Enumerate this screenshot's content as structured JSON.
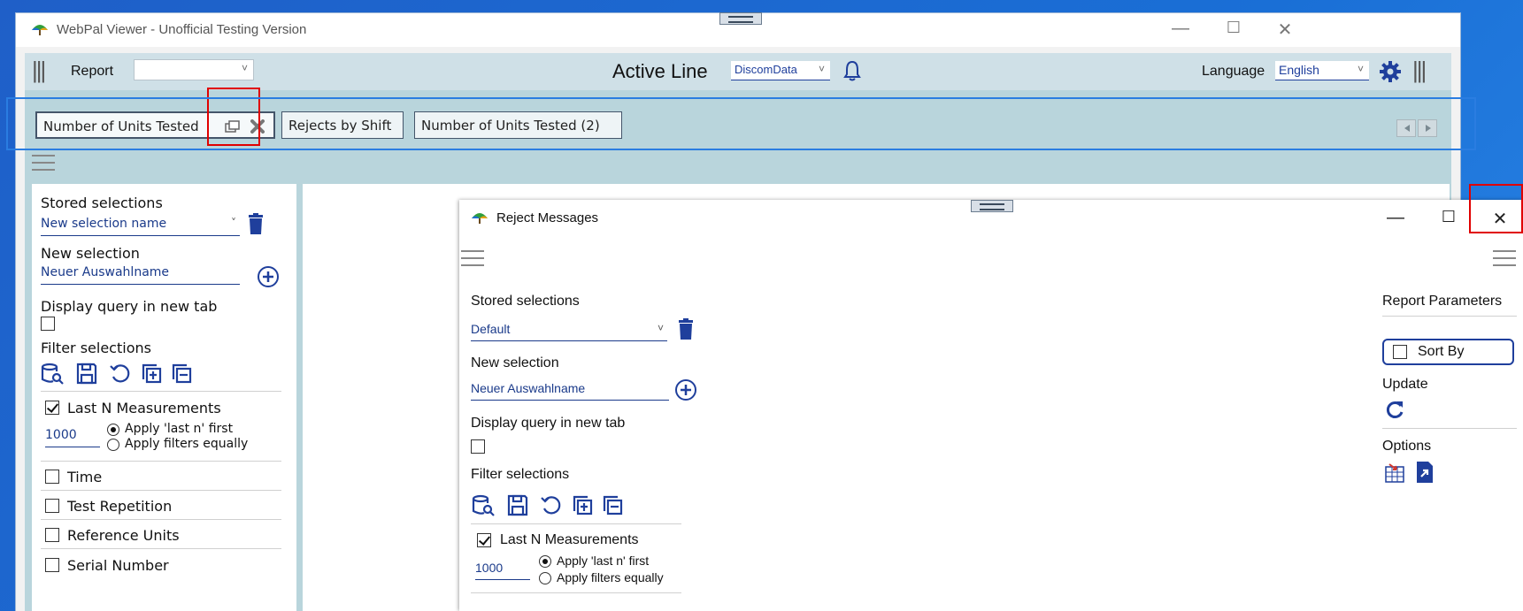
{
  "main_window": {
    "title": "WebPal Viewer - Unofficial Testing Version",
    "controls": {
      "minimize": "—",
      "maximize": "☐",
      "close": "✕"
    }
  },
  "toolbar": {
    "report_label": "Report",
    "report_value": "",
    "active_line_label": "Active Line",
    "active_line_value": "DiscomData",
    "language_label": "Language",
    "language_value": "English"
  },
  "tabs": [
    {
      "label": "Number of Units Tested"
    },
    {
      "label": "Rejects by Shift"
    },
    {
      "label": "Number of Units Tested (2)"
    }
  ],
  "left_panel": {
    "stored_selections_label": "Stored selections",
    "stored_selection_value": "New selection name",
    "new_selection_label": "New selection",
    "new_selection_value": "Neuer Auswahlname",
    "display_query_label": "Display query in new tab",
    "filter_selections_label": "Filter selections",
    "last_n_label": "Last N Measurements",
    "last_n_value": "1000",
    "apply_last_n": "Apply 'last n' first",
    "apply_equally": "Apply filters equally",
    "filters": [
      "Time",
      "Test Repetition",
      "Reference Units",
      "Serial Number"
    ]
  },
  "popup": {
    "title": "Reject Messages",
    "controls": {
      "minimize": "—",
      "maximize": "☐",
      "close": "✕"
    },
    "stored_selections_label": "Stored selections",
    "stored_selection_value": "Default",
    "new_selection_label": "New selection",
    "new_selection_value": "Neuer Auswahlname",
    "display_query_label": "Display query in new tab",
    "filter_selections_label": "Filter selections",
    "last_n_label": "Last N Measurements",
    "last_n_value": "1000",
    "apply_last_n": "Apply 'last n' first",
    "apply_equally": "Apply filters equally",
    "report_parameters_label": "Report Parameters",
    "sort_by_label": "Sort By",
    "update_label": "Update",
    "options_label": "Options"
  },
  "colors": {
    "toolbar_bg": "#cfe0e7",
    "teal_bg": "#b9d5dc",
    "accent_navy": "#1f3f9c",
    "highlight_red": "#e00000",
    "highlight_blue": "#2a7de1"
  }
}
